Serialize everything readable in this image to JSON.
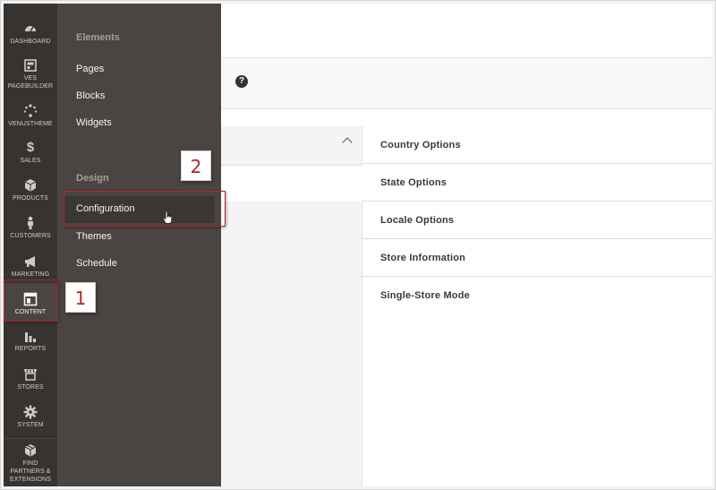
{
  "nav": {
    "items": [
      {
        "label": "DASHBOARD",
        "icon": "dashboard-icon"
      },
      {
        "label": "VES PAGEBUILDER",
        "icon": "pagebuilder-icon"
      },
      {
        "label": "VENUSTHEME",
        "icon": "venustheme-icon"
      },
      {
        "label": "SALES",
        "icon": "dollar-icon"
      },
      {
        "label": "PRODUCTS",
        "icon": "cube-icon"
      },
      {
        "label": "CUSTOMERS",
        "icon": "person-icon"
      },
      {
        "label": "MARKETING",
        "icon": "megaphone-icon"
      },
      {
        "label": "CONTENT",
        "icon": "content-icon",
        "active": true
      },
      {
        "label": "REPORTS",
        "icon": "bar-chart-icon"
      },
      {
        "label": "STORES",
        "icon": "store-icon"
      },
      {
        "label": "SYSTEM",
        "icon": "gear-icon"
      },
      {
        "label": "FIND PARTNERS & EXTENSIONS",
        "icon": "box-icon"
      }
    ]
  },
  "flyout": {
    "elements_heading": "Elements",
    "elements_links": [
      "Pages",
      "Blocks",
      "Widgets"
    ],
    "design_heading": "Design",
    "design_links": [
      "Configuration",
      "Themes",
      "Schedule"
    ]
  },
  "main": {
    "help_icon": "?",
    "sections": [
      "Country Options",
      "State Options",
      "Locale Options",
      "Store Information",
      "Single-Store Mode"
    ]
  },
  "annotations": {
    "callout_1": "1",
    "callout_2": "2",
    "highlight_color": "#b3242a"
  }
}
